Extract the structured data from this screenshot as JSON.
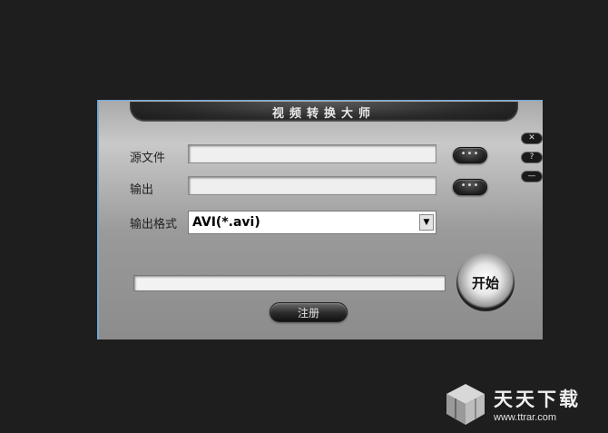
{
  "window": {
    "title": "视频转换大师"
  },
  "form": {
    "source_label": "源文件",
    "source_value": "",
    "output_label": "输出",
    "output_value": "",
    "format_label": "输出格式",
    "format_selected": "AVI(*.avi)",
    "browse_label": "•••"
  },
  "actions": {
    "start_label": "开始",
    "register_label": "注册"
  },
  "side_buttons": {
    "close_glyph": "✕",
    "help_glyph": "?",
    "minimize_glyph": "—"
  },
  "progress": {
    "value": 0
  },
  "watermark": {
    "name": "天天下载",
    "url": "www.ttrar.com"
  },
  "icons": [
    "close-icon",
    "help-icon",
    "minimize-icon",
    "dropdown-arrow-icon",
    "watermark-cube-icon"
  ]
}
